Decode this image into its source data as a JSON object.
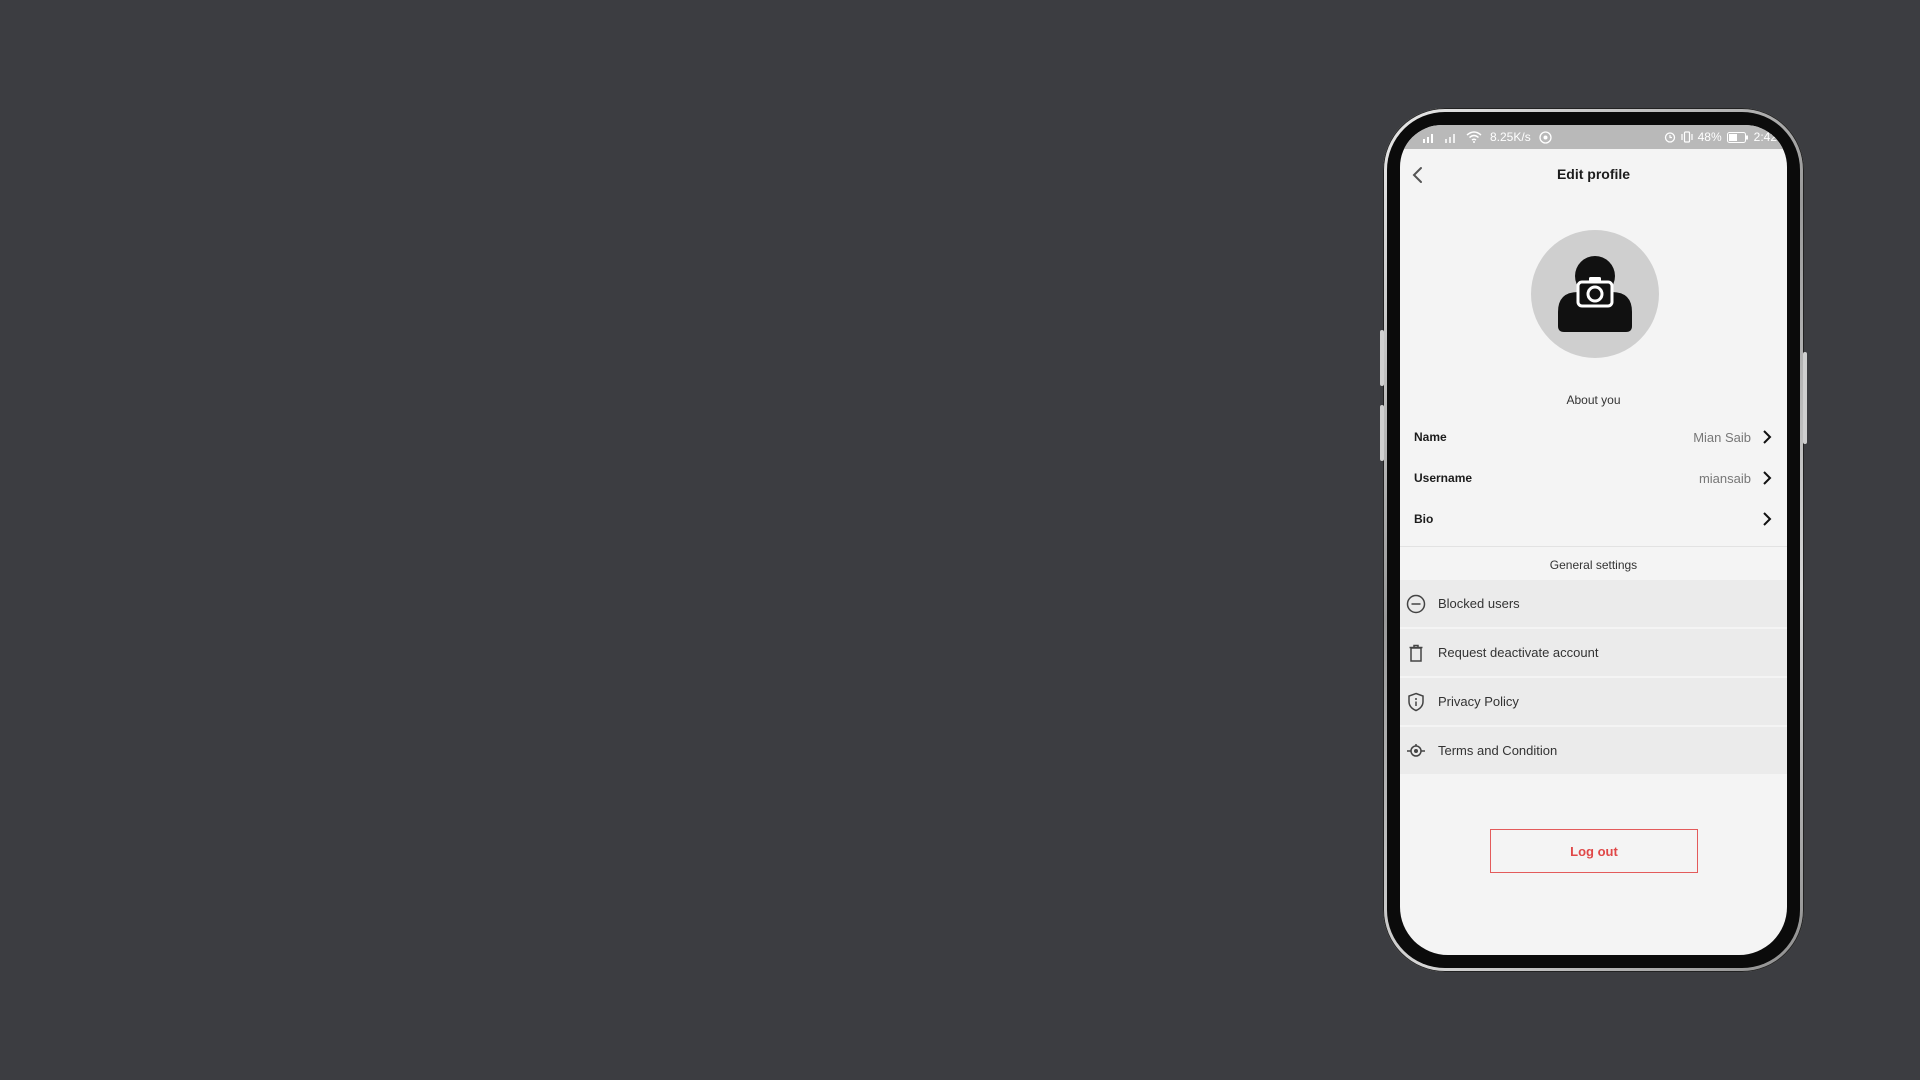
{
  "status_bar": {
    "speed": "8.25K/s",
    "battery": "48%",
    "time": "2:42"
  },
  "header": {
    "title": "Edit profile"
  },
  "about": {
    "section_label": "About you",
    "fields": [
      {
        "label": "Name",
        "value": "Mian Saib"
      },
      {
        "label": "Username",
        "value": "miansaib"
      },
      {
        "label": "Bio",
        "value": ""
      }
    ]
  },
  "general": {
    "section_label": "General settings",
    "items": [
      {
        "label": "Blocked users",
        "icon": "minus-circle-icon"
      },
      {
        "label": "Request deactivate account",
        "icon": "trash-icon"
      },
      {
        "label": "Privacy Policy",
        "icon": "shield-info-icon"
      },
      {
        "label": "Terms and Condition",
        "icon": "terms-icon"
      }
    ]
  },
  "logout_label": "Log out",
  "colors": {
    "background": "#3c3d41",
    "screen": "#f4f4f4",
    "accent": "#e04848",
    "avatar": "#cfcfcf"
  }
}
